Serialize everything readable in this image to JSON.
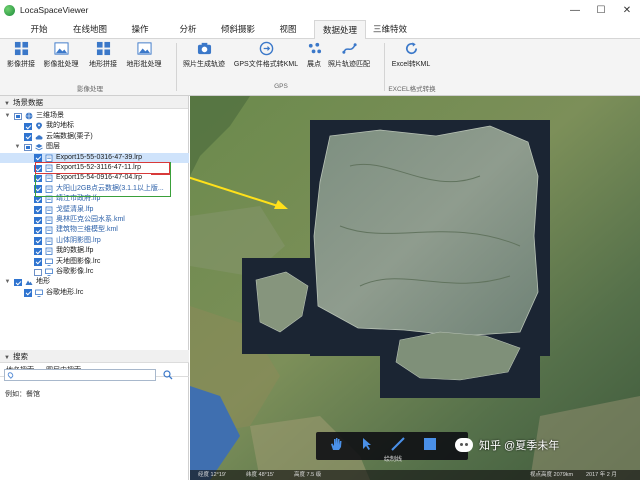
{
  "app": {
    "title": "LocaSpaceViewer"
  },
  "window": {
    "minimize": "—",
    "maximize": "☐",
    "close": "✕"
  },
  "menu_tabs": [
    "开始",
    "在线地图",
    "操作",
    "分析",
    "倾斜摄影",
    "视图",
    "数据处理",
    "三维特效"
  ],
  "active_menu_tab": "数据处理",
  "ribbon": {
    "buttons": [
      {
        "label": "影像拼接",
        "icon": "grid-icon"
      },
      {
        "label": "影像批处理",
        "icon": "image-icon"
      },
      {
        "label": "地形拼接",
        "icon": "grid-icon"
      },
      {
        "label": "地形批处理",
        "icon": "image-icon"
      },
      {
        "label": "照片生成轨迹",
        "icon": "camera-icon"
      },
      {
        "label": "GPS文件格式转KML",
        "icon": "convert-icon"
      },
      {
        "label": "展点",
        "icon": "scatter-icon"
      },
      {
        "label": "照片轨迹匹配",
        "icon": "match-icon"
      },
      {
        "label": "Excel转KML",
        "icon": "refresh-icon"
      }
    ],
    "groups": [
      "影像处理",
      "GPS",
      "EXCEL格式转换"
    ]
  },
  "scene_panel": {
    "title": "场景数据",
    "items": [
      {
        "label": "三维场景",
        "checkbox": "partial",
        "icon": "globe-icon",
        "expander": "▼"
      },
      {
        "label": "我的地标",
        "checkbox": "checked",
        "icon": "pin-icon",
        "expander": ""
      },
      {
        "label": "云端数据(栗子)",
        "checkbox": "checked",
        "icon": "cloud-icon",
        "expander": ""
      },
      {
        "label": "图层",
        "checkbox": "partial",
        "icon": "layers-icon",
        "expander": "▼"
      },
      {
        "label": "Export15-55-0316-47-39.lrp",
        "checkbox": "checked",
        "icon": "file-icon",
        "expander": "",
        "selected": true
      },
      {
        "label": "Export15-52-3116-47-11.lrp",
        "checkbox": "checked",
        "icon": "file-icon",
        "expander": ""
      },
      {
        "label": "Export15-54-0916-47-04.lrp",
        "checkbox": "checked",
        "icon": "file-icon",
        "expander": ""
      },
      {
        "label": "大阳山2GB点云数据(3.1.1以上版...",
        "checkbox": "checked",
        "icon": "file-icon",
        "expander": "",
        "link": true
      },
      {
        "label": "靖江市政府.lfp",
        "checkbox": "checked",
        "icon": "file-icon",
        "expander": "",
        "link": true
      },
      {
        "label": "戈壁清泉.lfp",
        "checkbox": "checked",
        "icon": "file-icon",
        "expander": "",
        "link": true
      },
      {
        "label": "奥林匹克公园水系.kml",
        "checkbox": "checked",
        "icon": "file-icon",
        "expander": "",
        "link": true
      },
      {
        "label": "建筑物三维模型.kml",
        "checkbox": "checked",
        "icon": "file-icon",
        "expander": "",
        "link": true
      },
      {
        "label": "山体阴影图.lrp",
        "checkbox": "checked",
        "icon": "file-icon",
        "expander": "",
        "link": true
      },
      {
        "label": "我的数据.lfp",
        "checkbox": "checked",
        "icon": "file-icon",
        "expander": ""
      },
      {
        "label": "天地图影像.lrc",
        "checkbox": "checked",
        "icon": "monitor-icon",
        "expander": ""
      },
      {
        "label": "谷歌影像.lrc",
        "checkbox": "unchecked",
        "icon": "monitor-icon",
        "expander": ""
      },
      {
        "label": "地形",
        "checkbox": "checked",
        "icon": "terrain-icon",
        "expander": "▼"
      },
      {
        "label": "谷歌地形.lrc",
        "checkbox": "checked",
        "icon": "monitor-icon",
        "expander": ""
      }
    ]
  },
  "search_panel": {
    "title": "搜索",
    "tabs": [
      "地名搜索",
      "图层内搜索"
    ],
    "input_value": "",
    "example": "例如：餐馆"
  },
  "map_status": {
    "lon": "经度 12°19'",
    "lat": "纬度 48°15'",
    "altitude": "高度 7.5 级",
    "eye_alt": "视点高度 2079km",
    "date": "2017 年 2 月"
  },
  "map_toolbar": {
    "label": "绘制线"
  },
  "watermark": "知乎 @夏季未年"
}
